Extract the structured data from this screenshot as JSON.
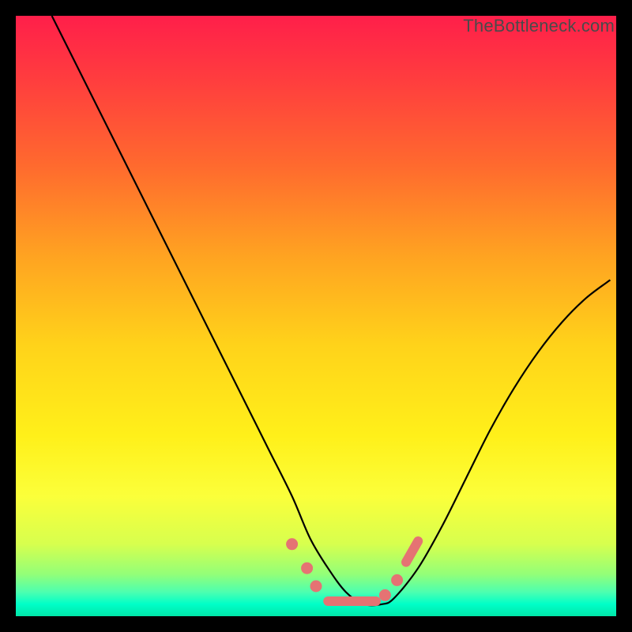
{
  "watermark": "TheBottleneck.com",
  "colors": {
    "frame": "#000000",
    "marker": "#e57373",
    "curve": "#000000"
  },
  "chart_data": {
    "type": "line",
    "title": "",
    "xlabel": "",
    "ylabel": "",
    "xlim": [
      0,
      100
    ],
    "ylim": [
      0,
      100
    ],
    "gradient_stops": [
      {
        "pos": 0,
        "color": "#ff1f4a"
      },
      {
        "pos": 10,
        "color": "#ff3b3f"
      },
      {
        "pos": 25,
        "color": "#ff6a2e"
      },
      {
        "pos": 40,
        "color": "#ffa321"
      },
      {
        "pos": 55,
        "color": "#ffd31a"
      },
      {
        "pos": 70,
        "color": "#fff01a"
      },
      {
        "pos": 80,
        "color": "#fbff3a"
      },
      {
        "pos": 88,
        "color": "#d7ff4e"
      },
      {
        "pos": 93,
        "color": "#93ff78"
      },
      {
        "pos": 96,
        "color": "#4cffb0"
      },
      {
        "pos": 98,
        "color": "#00ffc8"
      },
      {
        "pos": 100,
        "color": "#00e6a8"
      }
    ],
    "series": [
      {
        "name": "bottleneck-curve",
        "x": [
          6,
          10,
          14,
          18,
          22,
          26,
          30,
          34,
          38,
          42,
          46,
          49,
          52,
          55,
          58,
          61,
          63,
          67,
          71,
          75,
          79,
          83,
          87,
          91,
          95,
          99
        ],
        "y": [
          100,
          92,
          84,
          76,
          68,
          60,
          52,
          44,
          36,
          28,
          20,
          13,
          8,
          4,
          2,
          2,
          3,
          8,
          15,
          23,
          31,
          38,
          44,
          49,
          53,
          56
        ]
      }
    ],
    "markers": [
      {
        "type": "dot",
        "x": 46.0,
        "y": 12.0
      },
      {
        "type": "dot",
        "x": 48.5,
        "y": 8.0
      },
      {
        "type": "dot",
        "x": 50.0,
        "y": 5.0
      },
      {
        "type": "line",
        "x0": 52.0,
        "y0": 2.5,
        "x1": 60.0,
        "y1": 2.5
      },
      {
        "type": "dot",
        "x": 61.5,
        "y": 3.5
      },
      {
        "type": "dot",
        "x": 63.5,
        "y": 6.0
      },
      {
        "type": "line",
        "x0": 65.0,
        "y0": 9.0,
        "x1": 67.0,
        "y1": 12.5
      }
    ],
    "note": "x and y are percentages of the plot area (0=left/bottom, 100=right/top). Curve is decorative; no numeric axes are shown in the image."
  }
}
